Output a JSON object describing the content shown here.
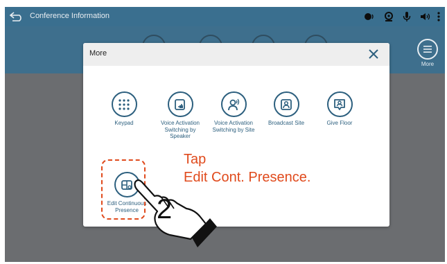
{
  "topbar": {
    "title": "Conference Information",
    "icons": [
      "speaker-icon",
      "webcam-icon",
      "microphone-icon",
      "volume-icon",
      "more-vert-icon"
    ]
  },
  "toolbar": {
    "more_label": "More"
  },
  "dialog": {
    "title": "More",
    "items": [
      {
        "label": "Keypad",
        "icon": "keypad-icon"
      },
      {
        "label": "Voice Activation Switching by Speaker",
        "icon": "voice-speaker-icon"
      },
      {
        "label": "Voice Activation Switching by Site",
        "icon": "voice-site-icon"
      },
      {
        "label": "Broadcast Site",
        "icon": "broadcast-site-icon"
      },
      {
        "label": "Give Floor",
        "icon": "give-floor-icon"
      },
      {
        "label": "Edit Continuous Presence",
        "icon": "edit-presence-icon"
      }
    ]
  },
  "annotation": {
    "instruction_line1": "Tap",
    "instruction_line2": "Edit Cont. Presence.",
    "step": "2"
  },
  "colors": {
    "topbar": "#3a6f8f",
    "accent": "#2c5f7e",
    "annotation": "#e04a1c",
    "overlay": "#6b6d70"
  }
}
